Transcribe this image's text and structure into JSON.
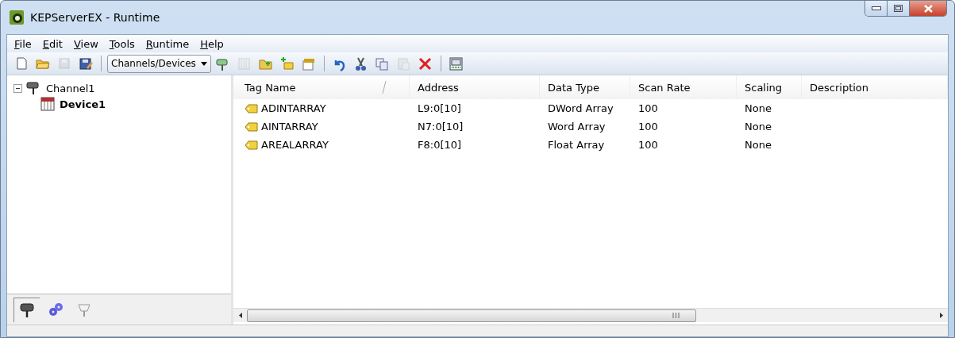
{
  "window": {
    "title": "KEPServerEX - Runtime"
  },
  "menu": [
    {
      "label": "File"
    },
    {
      "label": "Edit"
    },
    {
      "label": "View"
    },
    {
      "label": "Tools"
    },
    {
      "label": "Runtime"
    },
    {
      "label": "Help"
    }
  ],
  "toolbar": [
    {
      "kind": "new",
      "disabled": false
    },
    {
      "kind": "open",
      "disabled": false
    },
    {
      "kind": "save",
      "disabled": true
    },
    {
      "kind": "save-as",
      "disabled": false
    },
    {
      "kind": "separator"
    },
    {
      "kind": "dropdown",
      "value": "Channels/Devices"
    },
    {
      "kind": "channel",
      "disabled": false
    },
    {
      "kind": "device",
      "disabled": true
    },
    {
      "kind": "folder-add",
      "disabled": false
    },
    {
      "kind": "tag-add",
      "disabled": false
    },
    {
      "kind": "properties",
      "disabled": false
    },
    {
      "kind": "separator"
    },
    {
      "kind": "undo",
      "disabled": false
    },
    {
      "kind": "cut",
      "disabled": false
    },
    {
      "kind": "copy",
      "disabled": false
    },
    {
      "kind": "paste",
      "disabled": true
    },
    {
      "kind": "delete",
      "disabled": false
    },
    {
      "kind": "separator"
    },
    {
      "kind": "quick-client",
      "disabled": false
    }
  ],
  "tree": [
    {
      "label": "Channel1",
      "expanded": true,
      "selected": false,
      "children": [
        {
          "label": "Device1",
          "selected": true
        }
      ]
    }
  ],
  "sidebar_tabs": [
    {
      "kind": "channels",
      "selected": true
    },
    {
      "kind": "gears",
      "selected": false
    },
    {
      "kind": "connector",
      "selected": false
    }
  ],
  "table": {
    "columns": [
      "Tag Name",
      "Address",
      "Data Type",
      "Scan Rate",
      "Scaling",
      "Description"
    ],
    "rows": [
      {
        "tag_name": "ADINTARRAY",
        "address": "L9:0[10]",
        "data_type": "DWord Array",
        "scan_rate": "100",
        "scaling": "None"
      },
      {
        "tag_name": "AINTARRAY",
        "address": "N7:0[10]",
        "data_type": "Word Array",
        "scan_rate": "100",
        "scaling": "None"
      },
      {
        "tag_name": "AREALARRAY",
        "address": "F8:0[10]",
        "data_type": "Float Array",
        "scan_rate": "100",
        "scaling": "None"
      }
    ]
  }
}
